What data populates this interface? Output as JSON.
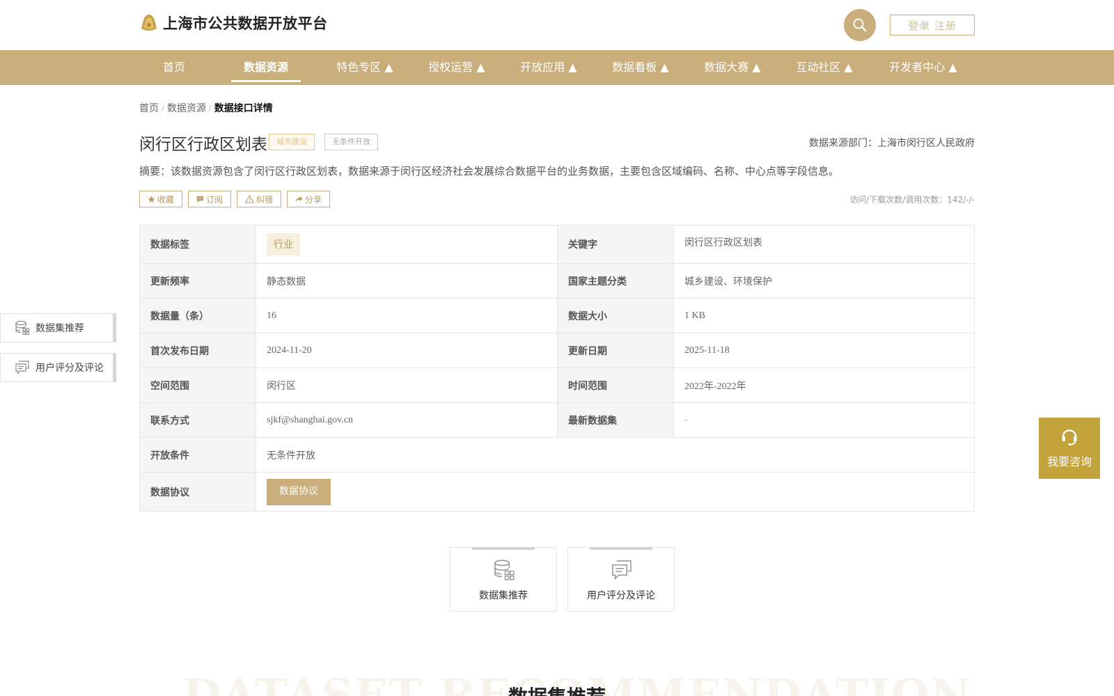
{
  "header": {
    "site_title": "上海市公共数据开放平台",
    "login_label": "登录 注册",
    "icons": {
      "logo": "shanghai-logo-icon",
      "search": "search-icon"
    }
  },
  "nav": {
    "items": [
      {
        "label": "首页"
      },
      {
        "label": "数据资源"
      },
      {
        "label": "特色专区 ▲"
      },
      {
        "label": "授权运营 ▲"
      },
      {
        "label": "开放应用 ▲"
      },
      {
        "label": "数据看板 ▲"
      },
      {
        "label": "数据大赛 ▲"
      },
      {
        "label": "互动社区 ▲"
      },
      {
        "label": "开发者中心 ▲"
      }
    ],
    "active_index": 1
  },
  "breadcrumb": {
    "items": [
      "首页",
      "数据资源"
    ],
    "separator": "/",
    "current": "数据接口详情"
  },
  "detail": {
    "title": "闵行区行政区划表",
    "tags": [
      "城市建设",
      "无条件开放"
    ],
    "source": "数据来源部门：上海市闵行区人民政府",
    "summary": "摘要：该数据资源包含了闵行区行政区划表，数据来源于闵行区经济社会发展综合数据平台的业务数据，主要包含区域编码、名称、中心点等字段信息。",
    "actions": [
      {
        "label": "收藏",
        "icon": "star-icon"
      },
      {
        "label": "订阅",
        "icon": "subscribe-icon"
      },
      {
        "label": "纠错",
        "icon": "warning-icon"
      },
      {
        "label": "分享",
        "icon": "share-icon"
      }
    ],
    "visits": "访问/下载次数/调用次数：142/-/-"
  },
  "table": {
    "data_tag": {
      "label": "数据标签",
      "value": "行业"
    },
    "keyword": {
      "label": "关键字",
      "value": "闵行区行政区划表"
    },
    "update_freq": {
      "label": "更新频率",
      "value": "静态数据"
    },
    "national_topic": {
      "label": "国家主题分类",
      "value": "城乡建设、环境保护"
    },
    "record_count": {
      "label": "数据量（条）",
      "value": "16"
    },
    "data_size": {
      "label": "数据大小",
      "value": "1 KB"
    },
    "first_publish": {
      "label": "首次发布日期",
      "value": "2024-11-20"
    },
    "update_date": {
      "label": "更新日期",
      "value": "2025-11-18"
    },
    "spatial": {
      "label": "空间范围",
      "value": "闵行区"
    },
    "temporal": {
      "label": "时间范围",
      "value": "2022年-2022年"
    },
    "contact": {
      "label": "联系方式",
      "value": "sjkf@shanghai.gov.cn"
    },
    "latest_dataset": {
      "label": "最新数据集",
      "value": "-"
    },
    "open_condition": {
      "label": "开放条件",
      "value": "无条件开放"
    },
    "agreement": {
      "label": "数据协议",
      "button": "数据协议"
    }
  },
  "side_float": [
    {
      "label": "数据集推荐",
      "icon": "database-icon"
    },
    {
      "label": "用户评分及评论",
      "icon": "comment-icon"
    }
  ],
  "consult": {
    "label": "我要咨询",
    "icon": "headset-icon"
  },
  "bottom_tabs": [
    {
      "label": "数据集推荐",
      "icon": "database-icon"
    },
    {
      "label": "用户评分及评论",
      "icon": "comment-icon"
    }
  ],
  "recommend_section": {
    "bg_word": "DATASET RECOMMENDATION",
    "title": "数据集推荐"
  },
  "colors": {
    "brand_gold": "#c9ae7b",
    "consult_gold": "#c2a23a"
  }
}
